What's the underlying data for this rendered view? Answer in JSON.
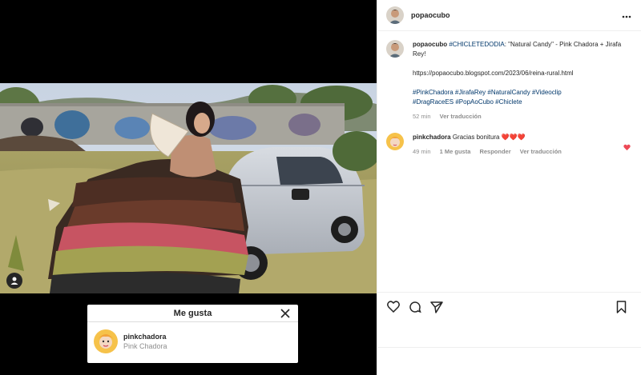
{
  "post": {
    "author": "popaocubo",
    "more_icon": "more-horizontal-icon",
    "caption": {
      "user": "popaocubo",
      "hashtag_main": "#CHICLETEDODIA",
      "text": ": \"Natural Candy\" - Pink Chadora + Jirafa Rey!",
      "url": "https://popaocubo.blogspot.com/2023/06/reina-rural.html",
      "hashtags_line1": "#PinkChadora #JirafaRey #NaturalCandy #Videoclip",
      "hashtags_line2": "#DragRaceES #PopAoCubo #Chiclete",
      "time": "52 min",
      "translate": "Ver traducción"
    },
    "comment": {
      "user": "pinkchadora",
      "text": "Gracias bonitura ❤️❤️❤️",
      "time": "49 min",
      "likes": "1 Me gusta",
      "reply": "Responder",
      "translate": "Ver traducción"
    }
  },
  "likes_modal": {
    "title": "Me gusta",
    "close_icon": "close-icon",
    "user": "pinkchadora",
    "name": "Pink Chadora"
  },
  "actions": {
    "like_icon": "heart-icon",
    "comment_icon": "comment-icon",
    "share_icon": "share-icon",
    "save_icon": "bookmark-icon"
  },
  "colors": {
    "link": "#00376b",
    "heart": "#ed4956",
    "muted": "#8e8e8e"
  }
}
